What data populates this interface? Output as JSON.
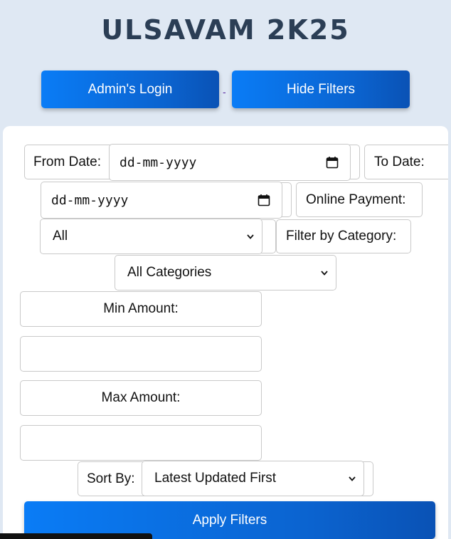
{
  "app": {
    "title": "ULSAVAM 2K25"
  },
  "header": {
    "admin_login_label": "Admin's Login",
    "separator": "-",
    "hide_filters_label": "Hide Filters"
  },
  "filters": {
    "from_date_label": "From Date:",
    "from_date_placeholder": "dd-mm-yyyy",
    "to_date_label": "To Date:",
    "to_date_placeholder": "dd-mm-yyyy",
    "online_payment_label": "Online Payment:",
    "online_payment_value": "All",
    "category_label": "Filter by Category:",
    "category_value": "All Categories",
    "min_amount_label": "Min Amount:",
    "min_amount_value": "",
    "max_amount_label": "Max Amount:",
    "max_amount_value": "",
    "sort_by_label": "Sort By:",
    "sort_by_value": "Latest Updated First",
    "apply_label": "Apply Filters"
  },
  "colors": {
    "background": "#dfe8f3",
    "accent": "#0a7cf6",
    "title": "#2b3e55"
  }
}
